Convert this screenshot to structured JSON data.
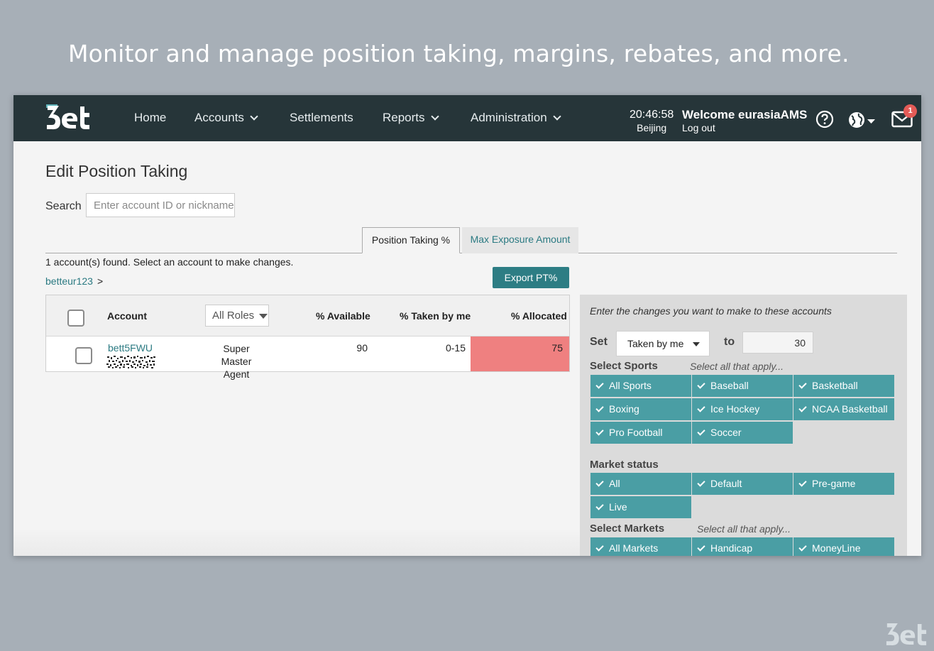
{
  "headline": "Monitor and manage position taking, margins, rebates, and more.",
  "nav": {
    "logo_alt": "3et",
    "items": [
      {
        "label": "Home",
        "dropdown": false
      },
      {
        "label": "Accounts",
        "dropdown": true
      },
      {
        "label": "Settlements",
        "dropdown": false
      },
      {
        "label": "Reports",
        "dropdown": true
      },
      {
        "label": "Administration",
        "dropdown": true
      }
    ],
    "time": "20:46:58",
    "city": "Beijing",
    "welcome": "Welcome eurasiaAMS",
    "logout": "Log out",
    "mail_badge": "1",
    "icons": [
      "help-icon",
      "globe-icon",
      "mail-icon"
    ]
  },
  "page": {
    "title": "Edit Position Taking",
    "search_label": "Search",
    "search_placeholder": "Enter account ID or nickname",
    "tabs": [
      {
        "label": "Position Taking %",
        "active": true
      },
      {
        "label": "Max Exposure Amount",
        "active": false
      }
    ],
    "found_text": "1 account(s) found. Select an account to make changes.",
    "breadcrumb": "betteur123",
    "breadcrumb_sep": ">",
    "export_label": "Export PT%"
  },
  "table": {
    "headers": {
      "account": "Account",
      "roles": "All Roles",
      "available": "% Available",
      "taken": "% Taken by me",
      "allocated": "% Allocated"
    },
    "rows": [
      {
        "account": "bett5FWU",
        "role_line1": "Super Master",
        "role_line2": "Agent",
        "available": "90",
        "taken": "0-15",
        "allocated": "75"
      }
    ]
  },
  "panel": {
    "hint": "Enter the changes you want to make to these accounts",
    "set_label": "Set",
    "set_value": "Taken by me",
    "to_label": "to",
    "to_value": "30",
    "sports_title": "Select Sports",
    "sports_hint": "Select all that apply...",
    "sports": [
      "All Sports",
      "Baseball",
      "Basketball",
      "Boxing",
      "Ice Hockey",
      "NCAA Basketball",
      "Pro Football",
      "Soccer"
    ],
    "market_status_title": "Market status",
    "market_status": [
      "All",
      "Default",
      "Pre-game",
      "Live"
    ],
    "markets_title": "Select Markets",
    "markets_hint": "Select all that apply...",
    "markets": [
      "All Markets",
      "Handicap",
      "MoneyLine"
    ]
  },
  "colors": {
    "nav_bg": "#263539",
    "accent": "#2d7d84",
    "chip": "#4a9ea4",
    "allocated_cell": "#ef8080",
    "badge": "#e45b57"
  }
}
